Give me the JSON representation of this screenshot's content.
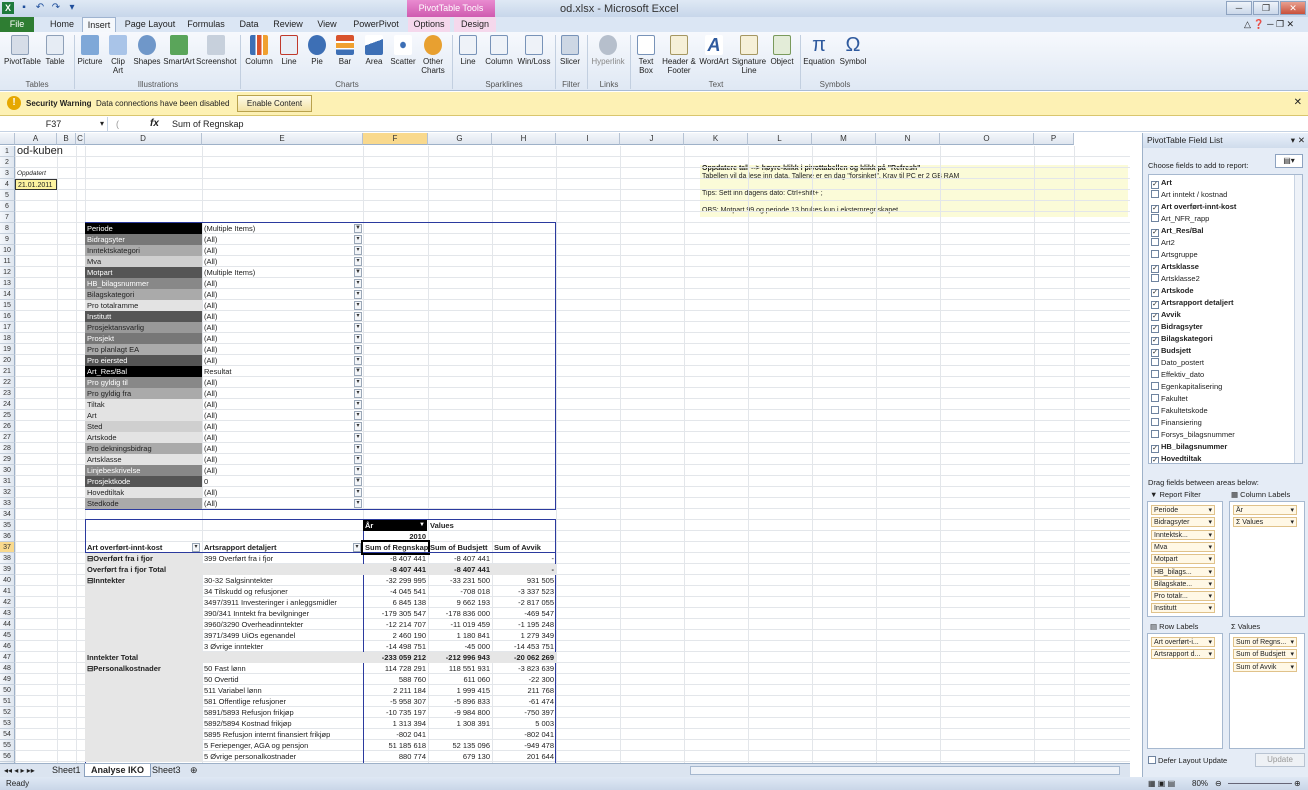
{
  "window": {
    "title": "od.xlsx - Microsoft Excel",
    "context_tab_group": "PivotTable Tools"
  },
  "tabs": [
    "File",
    "Home",
    "Insert",
    "Page Layout",
    "Formulas",
    "Data",
    "Review",
    "View",
    "PowerPivot",
    "Options",
    "Design"
  ],
  "ribbon": {
    "buttons": [
      "PivotTable",
      "Table",
      "Picture",
      "Clip Art",
      "Shapes",
      "SmartArt",
      "Screenshot",
      "Column",
      "Line",
      "Pie",
      "Bar",
      "Area",
      "Scatter",
      "Other Charts",
      "Line",
      "Column",
      "Win/Loss",
      "Slicer",
      "Hyperlink",
      "Text Box",
      "Header & Footer",
      "WordArt",
      "Signature Line",
      "Object",
      "Equation",
      "Symbol"
    ],
    "groups": [
      "Tables",
      "Illustrations",
      "Charts",
      "Sparklines",
      "Filter",
      "Links",
      "Text",
      "Symbols"
    ]
  },
  "security_bar": {
    "title": "Security Warning",
    "message": "Data connections have been disabled",
    "button": "Enable Content"
  },
  "formula_bar": {
    "name_box": "F37",
    "fx": "fx",
    "formula": "Sum of Regnskap"
  },
  "columns": [
    "A",
    "B",
    "C",
    "D",
    "E",
    "F",
    "G",
    "H",
    "I",
    "J",
    "K",
    "L",
    "M",
    "N",
    "O",
    "P"
  ],
  "sheet": {
    "title": "od-kuben",
    "updated_label": "Oppdatert",
    "updated_date": "21.01.2011",
    "notes": [
      "Oppdatere tall --> høyre-klikk i pivottabellen og klikk  på \"Refresh\"",
      "Tabellen vil da lese inn data. Tallene er en dag \"forsinket\".  Krav til PC  er 2 GB RAM",
      "Tips: Sett inn dagens dato: Ctrl+shift+ ;",
      "OBS: Motpart 99 og periode 13 brukes kun i eksternregnskapet"
    ]
  },
  "filters": [
    {
      "name": "Periode",
      "value": "(Multiple Items)",
      "filtered": true
    },
    {
      "name": "Bidragsyter",
      "value": "(All)"
    },
    {
      "name": "Inntektskategori",
      "value": "(All)"
    },
    {
      "name": "Mva",
      "value": "(All)"
    },
    {
      "name": "Motpart",
      "value": "(Multiple Items)",
      "filtered": true
    },
    {
      "name": "HB_bilagsnummer",
      "value": "(All)"
    },
    {
      "name": "Bilagskategori",
      "value": "(All)"
    },
    {
      "name": "Pro totalramme",
      "value": "(All)"
    },
    {
      "name": "Institutt",
      "value": "(All)"
    },
    {
      "name": "Prosjektansvarlig",
      "value": "(All)"
    },
    {
      "name": "Prosjekt",
      "value": "(All)"
    },
    {
      "name": "Pro planlagt EA",
      "value": "(All)"
    },
    {
      "name": "Pro eiersted",
      "value": "(All)"
    },
    {
      "name": "Art_Res/Bal",
      "value": "Resultat",
      "filtered": true
    },
    {
      "name": "Pro gyldig til",
      "value": "(All)"
    },
    {
      "name": "Pro gyldig fra",
      "value": "(All)"
    },
    {
      "name": "Tiltak",
      "value": "(All)"
    },
    {
      "name": "Art",
      "value": "(All)"
    },
    {
      "name": "Sted",
      "value": "(All)"
    },
    {
      "name": "Artskode",
      "value": "(All)"
    },
    {
      "name": "Pro dekningsbidrag",
      "value": "(All)"
    },
    {
      "name": "Artsklasse",
      "value": "(All)"
    },
    {
      "name": "Linjebeskrivelse",
      "value": "(All)"
    },
    {
      "name": "Prosjektkode",
      "value": "0",
      "filtered": true
    },
    {
      "name": "Hovedtiltak",
      "value": "(All)"
    },
    {
      "name": "Stedkode",
      "value": "(All)"
    }
  ],
  "pivot": {
    "col_field": "År",
    "values_label": "Values",
    "year": "2010",
    "row_headers": [
      "Art overført-innt-kost",
      "Artsrapport detaljert"
    ],
    "value_headers": [
      "Sum of Regnskap",
      "Sum of Budsjett",
      "Sum of Avvik"
    ],
    "rows": [
      {
        "a": "⊟Overført fra i fjor",
        "b": "399 Overført fra i fjor",
        "v": [
          "-8 407 441",
          "-8 407 441",
          "-"
        ]
      },
      {
        "a": "Overført fra i fjor Total",
        "b": "",
        "v": [
          "-8 407 441",
          "-8 407 441",
          "-"
        ],
        "total": true
      },
      {
        "a": "⊟Inntekter",
        "b": "30-32 Salgsinntekter",
        "v": [
          "-32 299 995",
          "-33 231 500",
          "931 505"
        ]
      },
      {
        "a": "",
        "b": "34 Tilskudd og refusjoner",
        "v": [
          "-4 045 541",
          "-708 018",
          "-3 337 523"
        ]
      },
      {
        "a": "",
        "b": "3497/3911 Investeringer i anleggsmidler",
        "v": [
          "6 845 138",
          "9 662 193",
          "-2 817 055"
        ]
      },
      {
        "a": "",
        "b": "390/341 Inntekt fra bevilgninger",
        "v": [
          "-179 305 547",
          "-178 836 000",
          "-469 547"
        ]
      },
      {
        "a": "",
        "b": "3960/3290 Overheadinntekter",
        "v": [
          "-12 214 707",
          "-11 019 459",
          "-1 195 248"
        ]
      },
      {
        "a": "",
        "b": "3971/3499 UiOs egenandel",
        "v": [
          "2 460 190",
          "1 180 841",
          "1 279 349"
        ]
      },
      {
        "a": "",
        "b": "3 Øvrige inntekter",
        "v": [
          "-14 498 751",
          "-45 000",
          "-14 453 751"
        ]
      },
      {
        "a": "Inntekter Total",
        "b": "",
        "v": [
          "-233 059 212",
          "-212 996 943",
          "-20 062 269"
        ],
        "total": true
      },
      {
        "a": "⊟Personalkostnader",
        "b": "50 Fast lønn",
        "v": [
          "114 728 291",
          "118 551 931",
          "-3 823 639"
        ]
      },
      {
        "a": "",
        "b": "50 Overtid",
        "v": [
          "588 760",
          "611 060",
          "-22 300"
        ]
      },
      {
        "a": "",
        "b": "511 Variabel lønn",
        "v": [
          "2 211 184",
          "1 999 415",
          "211 768"
        ]
      },
      {
        "a": "",
        "b": "581 Offentlige refusjoner",
        "v": [
          "-5 958 307",
          "-5 896 833",
          "-61 474"
        ]
      },
      {
        "a": "",
        "b": "5891/5893 Refusjon frikjøp",
        "v": [
          "-10 735 197",
          "-9 984 800",
          "-750 397"
        ]
      },
      {
        "a": "",
        "b": "5892/5894 Kostnad frikjøp",
        "v": [
          "1 313 394",
          "1 308 391",
          "5 003"
        ]
      },
      {
        "a": "",
        "b": "5895 Refusjon internt finansiert frikjøp",
        "v": [
          "-802 041",
          "",
          "-802 041"
        ]
      },
      {
        "a": "",
        "b": "5 Feriepenger, AGA og pensjon",
        "v": [
          "51 185 618",
          "52 135 096",
          "-949 478"
        ]
      },
      {
        "a": "",
        "b": "5 Øvrige personalkostnader",
        "v": [
          "880 774",
          "679 130",
          "201 644"
        ]
      }
    ]
  },
  "sheet_tabs": [
    "Sheet1",
    "Analyse IKO",
    "Sheet3"
  ],
  "status": {
    "ready": "Ready",
    "zoom": "80%"
  },
  "field_list": {
    "title": "PivotTable Field List",
    "choose": "Choose fields to add to report:",
    "fields": [
      {
        "name": "Art",
        "checked": true
      },
      {
        "name": "Art inntekt / kostnad",
        "checked": false
      },
      {
        "name": "Art overført-innt-kost",
        "checked": true
      },
      {
        "name": "Art_NFR_rapp",
        "checked": false
      },
      {
        "name": "Art_Res/Bal",
        "checked": true
      },
      {
        "name": "Art2",
        "checked": false
      },
      {
        "name": "Artsgruppe",
        "checked": false
      },
      {
        "name": "Artsklasse",
        "checked": true
      },
      {
        "name": "Artsklasse2",
        "checked": false
      },
      {
        "name": "Artskode",
        "checked": true
      },
      {
        "name": "Artsrapport detaljert",
        "checked": true
      },
      {
        "name": "Avvik",
        "checked": true
      },
      {
        "name": "Bidragsyter",
        "checked": true
      },
      {
        "name": "Bilagskategori",
        "checked": true
      },
      {
        "name": "Budsjett",
        "checked": true
      },
      {
        "name": "Dato_postert",
        "checked": false
      },
      {
        "name": "Effektiv_dato",
        "checked": false
      },
      {
        "name": "Egenkapitalisering",
        "checked": false
      },
      {
        "name": "Fakultet",
        "checked": false
      },
      {
        "name": "Fakultetskode",
        "checked": false
      },
      {
        "name": "Finansiering",
        "checked": false
      },
      {
        "name": "Forsys_bilagsnummer",
        "checked": false
      },
      {
        "name": "HB_bilagsnummer",
        "checked": true
      },
      {
        "name": "Hovedtiltak",
        "checked": true
      }
    ],
    "drag_label": "Drag fields between areas below:",
    "report_filter": "Report Filter",
    "column_labels": "Column Labels",
    "row_labels": "Row Labels",
    "values": "Values",
    "filter_chips": [
      "Periode",
      "Bidragsyter",
      "Inntektsk...",
      "Mva",
      "Motpart",
      "HB_bilags...",
      "Bilagskate...",
      "Pro totalr...",
      "Institutt"
    ],
    "column_chips": [
      "År",
      "Σ Values"
    ],
    "row_chips": [
      "Art overført-i...",
      "Artsrapport d..."
    ],
    "value_chips": [
      "Sum of Regns...",
      "Sum of Budsjett",
      "Sum of Avvik"
    ],
    "defer": "Defer Layout Update",
    "update": "Update"
  }
}
